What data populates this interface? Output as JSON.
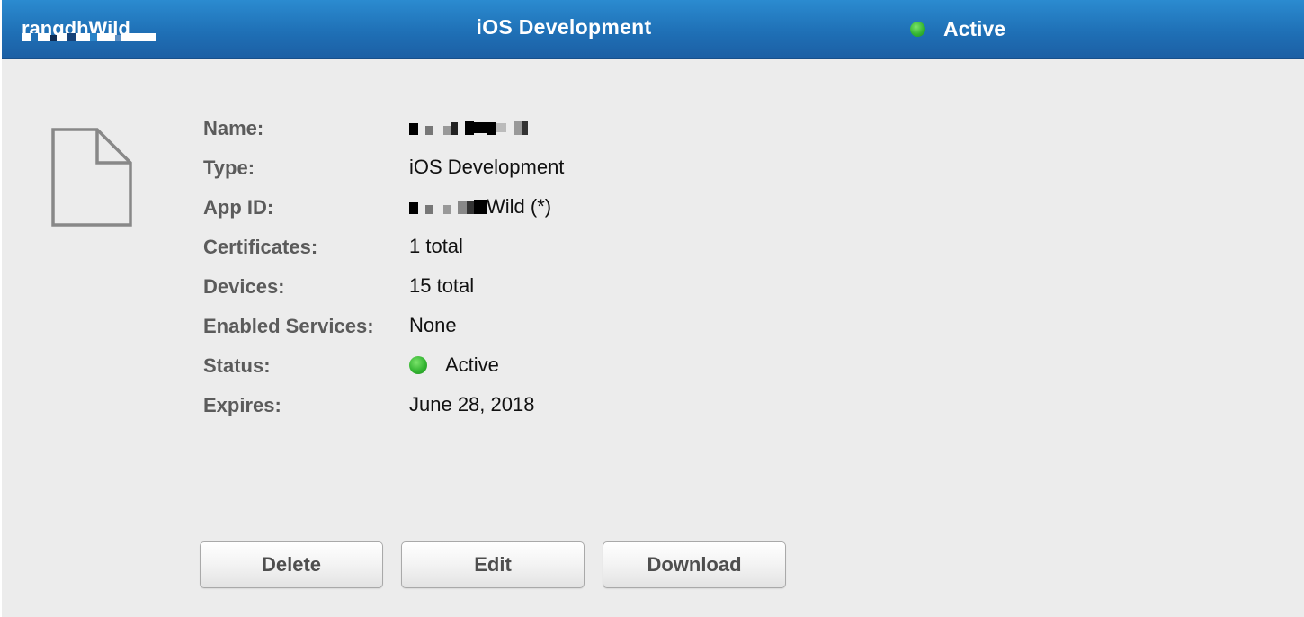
{
  "header": {
    "name": "rangdhWild",
    "title": "iOS Development",
    "status": "Active",
    "status_color": "#34b532",
    "bar_color": "#1f70b6"
  },
  "profile": {
    "icon": "document-icon",
    "fields": [
      {
        "label": "Name:",
        "value": "rangdhWild"
      },
      {
        "label": "Type:",
        "value": "iOS Development"
      },
      {
        "label": "App ID:",
        "value": "Wild (*)"
      },
      {
        "label": "Certificates:",
        "value": "1 total"
      },
      {
        "label": "Devices:",
        "value": "15 total"
      },
      {
        "label": "Enabled Services:",
        "value": "None"
      },
      {
        "label": "Status:",
        "value": "Active"
      },
      {
        "label": "Expires:",
        "value": "June 28, 2018"
      }
    ]
  },
  "actions": {
    "delete": "Delete",
    "edit": "Edit",
    "download": "Download"
  }
}
